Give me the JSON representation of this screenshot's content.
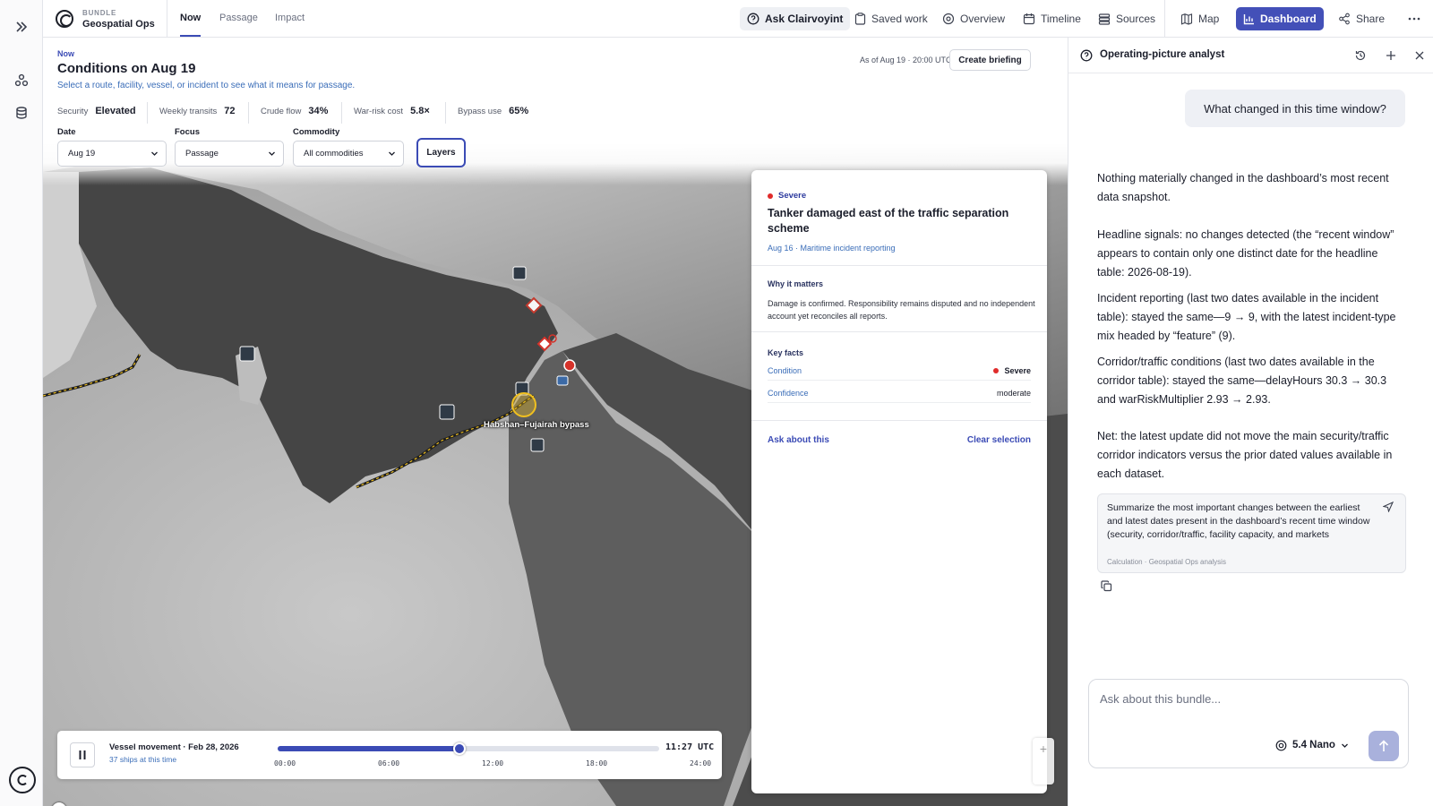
{
  "topbar": {
    "brand_kicker": "BUNDLE",
    "brand_name": "Geospatial Ops",
    "tabs": [
      {
        "label": "Now",
        "active": true
      },
      {
        "label": "Passage",
        "active": false
      },
      {
        "label": "Impact",
        "active": false
      }
    ],
    "actions": {
      "ask": "Ask Clairvoyint",
      "saved": "Saved work",
      "overview": "Overview",
      "timeline": "Timeline",
      "sources": "Sources",
      "map": "Map",
      "dashboard": "Dashboard",
      "share": "Share"
    }
  },
  "header": {
    "kicker": "Now",
    "title": "Conditions on Aug 19",
    "subtitle": "Select a route, facility, vessel, or incident to see what it means for passage.",
    "as_of": "As of Aug 19 · 20:00 UTC",
    "create_briefing": "Create briefing"
  },
  "metrics": [
    {
      "label": "Security",
      "value": "Elevated"
    },
    {
      "label": "Weekly transits",
      "value": "72"
    },
    {
      "label": "Crude flow",
      "value": "34%"
    },
    {
      "label": "War-risk cost",
      "value": "5.8×"
    },
    {
      "label": "Bypass use",
      "value": "65%"
    }
  ],
  "filters": {
    "date": {
      "label": "Date",
      "value": "Aug 19"
    },
    "focus": {
      "label": "Focus",
      "value": "Passage"
    },
    "commodity": {
      "label": "Commodity",
      "value": "All commodities"
    },
    "layers": "Layers"
  },
  "map": {
    "route_label": "Habshan–Fujairah bypass"
  },
  "incident": {
    "severity": "Severe",
    "title": "Tanker damaged east of the traffic separation scheme",
    "meta": "Aug 16 · Maritime incident reporting",
    "why_heading": "Why it matters",
    "why_text": "Damage is confirmed. Responsibility remains disputed and no independent account yet reconciles all reports.",
    "facts_heading": "Key facts",
    "facts": [
      {
        "key": "Condition",
        "value": "Severe"
      },
      {
        "key": "Confidence",
        "value": "moderate"
      }
    ],
    "ask_link": "Ask about this",
    "clear_link": "Clear selection",
    "severity_color": "#e02b2b"
  },
  "timeline": {
    "title": "Vessel movement · Feb 28, 2026",
    "subtitle": "37 ships at this time",
    "ticks": [
      "00:00",
      "06:00",
      "12:00",
      "18:00",
      "24:00"
    ],
    "current_time": "11:27 UTC",
    "progress": 0.477
  },
  "assistant": {
    "title": "Operating-picture analyst",
    "user_question": "What changed in this time window?",
    "answer": [
      "Nothing materially changed in the dashboard’s most recent data snapshot.",
      "Headline signals: no changes detected (the “recent window” appears to contain only one distinct date for the headline table: 2026-08-19).",
      "Incident reporting (last two dates available in the incident table): stayed the same—9 → 9, with the latest incident-type mix headed by “feature” (9).",
      "Corridor/traffic conditions (last two dates available in the corridor table): stayed the same—delayHours 30.3 → 30.3 and warRiskMultiplier 2.93 → 2.93.",
      "Net: the latest update did not move the main security/traffic corridor indicators versus the prior dated values available in each dataset."
    ],
    "citation": {
      "text": "Summarize the most important changes between the earliest and latest dates present in the dashboard’s recent time window (security, corridor/traffic, facility capacity, and markets",
      "meta": "Calculation · Geospatial Ops analysis"
    },
    "input_placeholder": "Ask about this bundle...",
    "model": "5.4 Nano"
  },
  "colors": {
    "accent": "#4350b8",
    "link": "#3a6db8",
    "severe": "#e02b2b"
  }
}
